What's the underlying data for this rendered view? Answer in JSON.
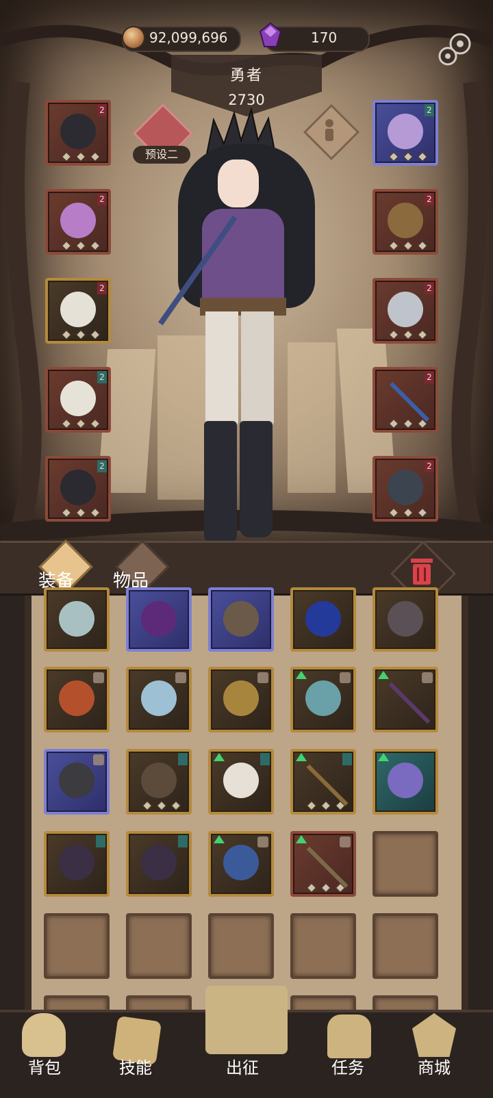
{
  "currency": {
    "gold": "92,099,696",
    "gems": "170"
  },
  "hero": {
    "name": "勇者",
    "power": "2730"
  },
  "preset": {
    "label": "预设二"
  },
  "equipment": {
    "left": [
      {
        "item": "crown-icon",
        "badge": "2"
      },
      {
        "item": "blouse-icon",
        "badge": "2"
      },
      {
        "item": "gloves-icon",
        "badge": "2"
      },
      {
        "item": "pants-icon",
        "badge": "2"
      },
      {
        "item": "boots-icon",
        "badge": "2"
      }
    ],
    "right": [
      {
        "item": "amulet-icon",
        "badge": "2"
      },
      {
        "item": "ring-icon",
        "badge": "2"
      },
      {
        "item": "medallion-icon",
        "badge": "2"
      },
      {
        "item": "staff-icon",
        "badge": "2"
      },
      {
        "item": "wolf-mask-icon",
        "badge": "2"
      }
    ]
  },
  "tabs": {
    "equipment": "装备",
    "items": "物品"
  },
  "nav": {
    "backpack": "背包",
    "skills": "技能",
    "expedition": "出征",
    "tasks": "任务",
    "shop": "商城"
  },
  "colors": {
    "rare_red": "#8c4a39",
    "rare_gold": "#b48a3d",
    "rare_purple": "#7d7fd2",
    "upgrade_green": "#42d36e"
  }
}
